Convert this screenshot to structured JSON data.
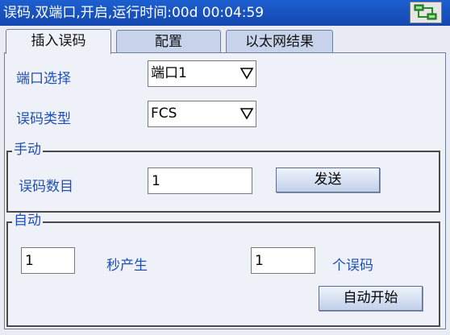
{
  "titlebar": {
    "text": "误码,双端口,开启,运行时间:00d 00:04:59",
    "network_icon": "network-icon"
  },
  "tabs": [
    {
      "label": "插入误码",
      "active": true
    },
    {
      "label": "配置",
      "active": false
    },
    {
      "label": "以太网结果",
      "active": false
    }
  ],
  "form": {
    "port_label": "端口选择",
    "port_value": "端口1",
    "type_label": "误码类型",
    "type_value": "FCS"
  },
  "manual": {
    "title": "手动",
    "count_label": "误码数目",
    "count_value": "1",
    "send_label": "发送"
  },
  "auto": {
    "title": "自动",
    "interval_value": "1",
    "interval_label": "秒产生",
    "count_value": "1",
    "count_label": "个误码",
    "start_label": "自动开始"
  },
  "colors": {
    "titlebar": "#1c5fd0",
    "label_blue": "#1f4fb5",
    "tab_inactive": "#c6d3ea",
    "panel_bg": "#eef1f7"
  }
}
